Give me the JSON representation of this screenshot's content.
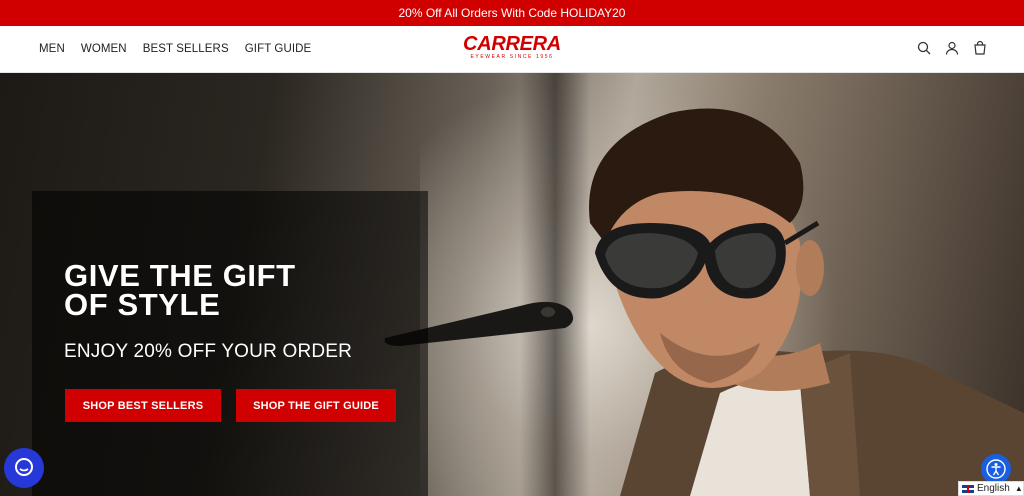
{
  "promo": {
    "text": "20% Off All Orders With Code HOLIDAY20"
  },
  "nav": {
    "items": [
      "MEN",
      "WOMEN",
      "BEST SELLERS",
      "GIFT GUIDE"
    ]
  },
  "logo": {
    "wordmark": "CARRERA",
    "tagline": "EYEWEAR SINCE 1956"
  },
  "header_icons": [
    "search-icon",
    "account-icon",
    "cart-icon"
  ],
  "hero": {
    "headline_line1": "GIVE THE GIFT",
    "headline_line2": "OF STYLE",
    "subheadline": "ENJOY 20% OFF YOUR ORDER",
    "cta_primary": "SHOP BEST SELLERS",
    "cta_secondary": "SHOP THE GIFT GUIDE"
  },
  "language": {
    "label": "English"
  },
  "colors": {
    "brand_red": "#d00000",
    "chat_blue": "#2638d8",
    "a11y_blue": "#1a5fe0"
  }
}
